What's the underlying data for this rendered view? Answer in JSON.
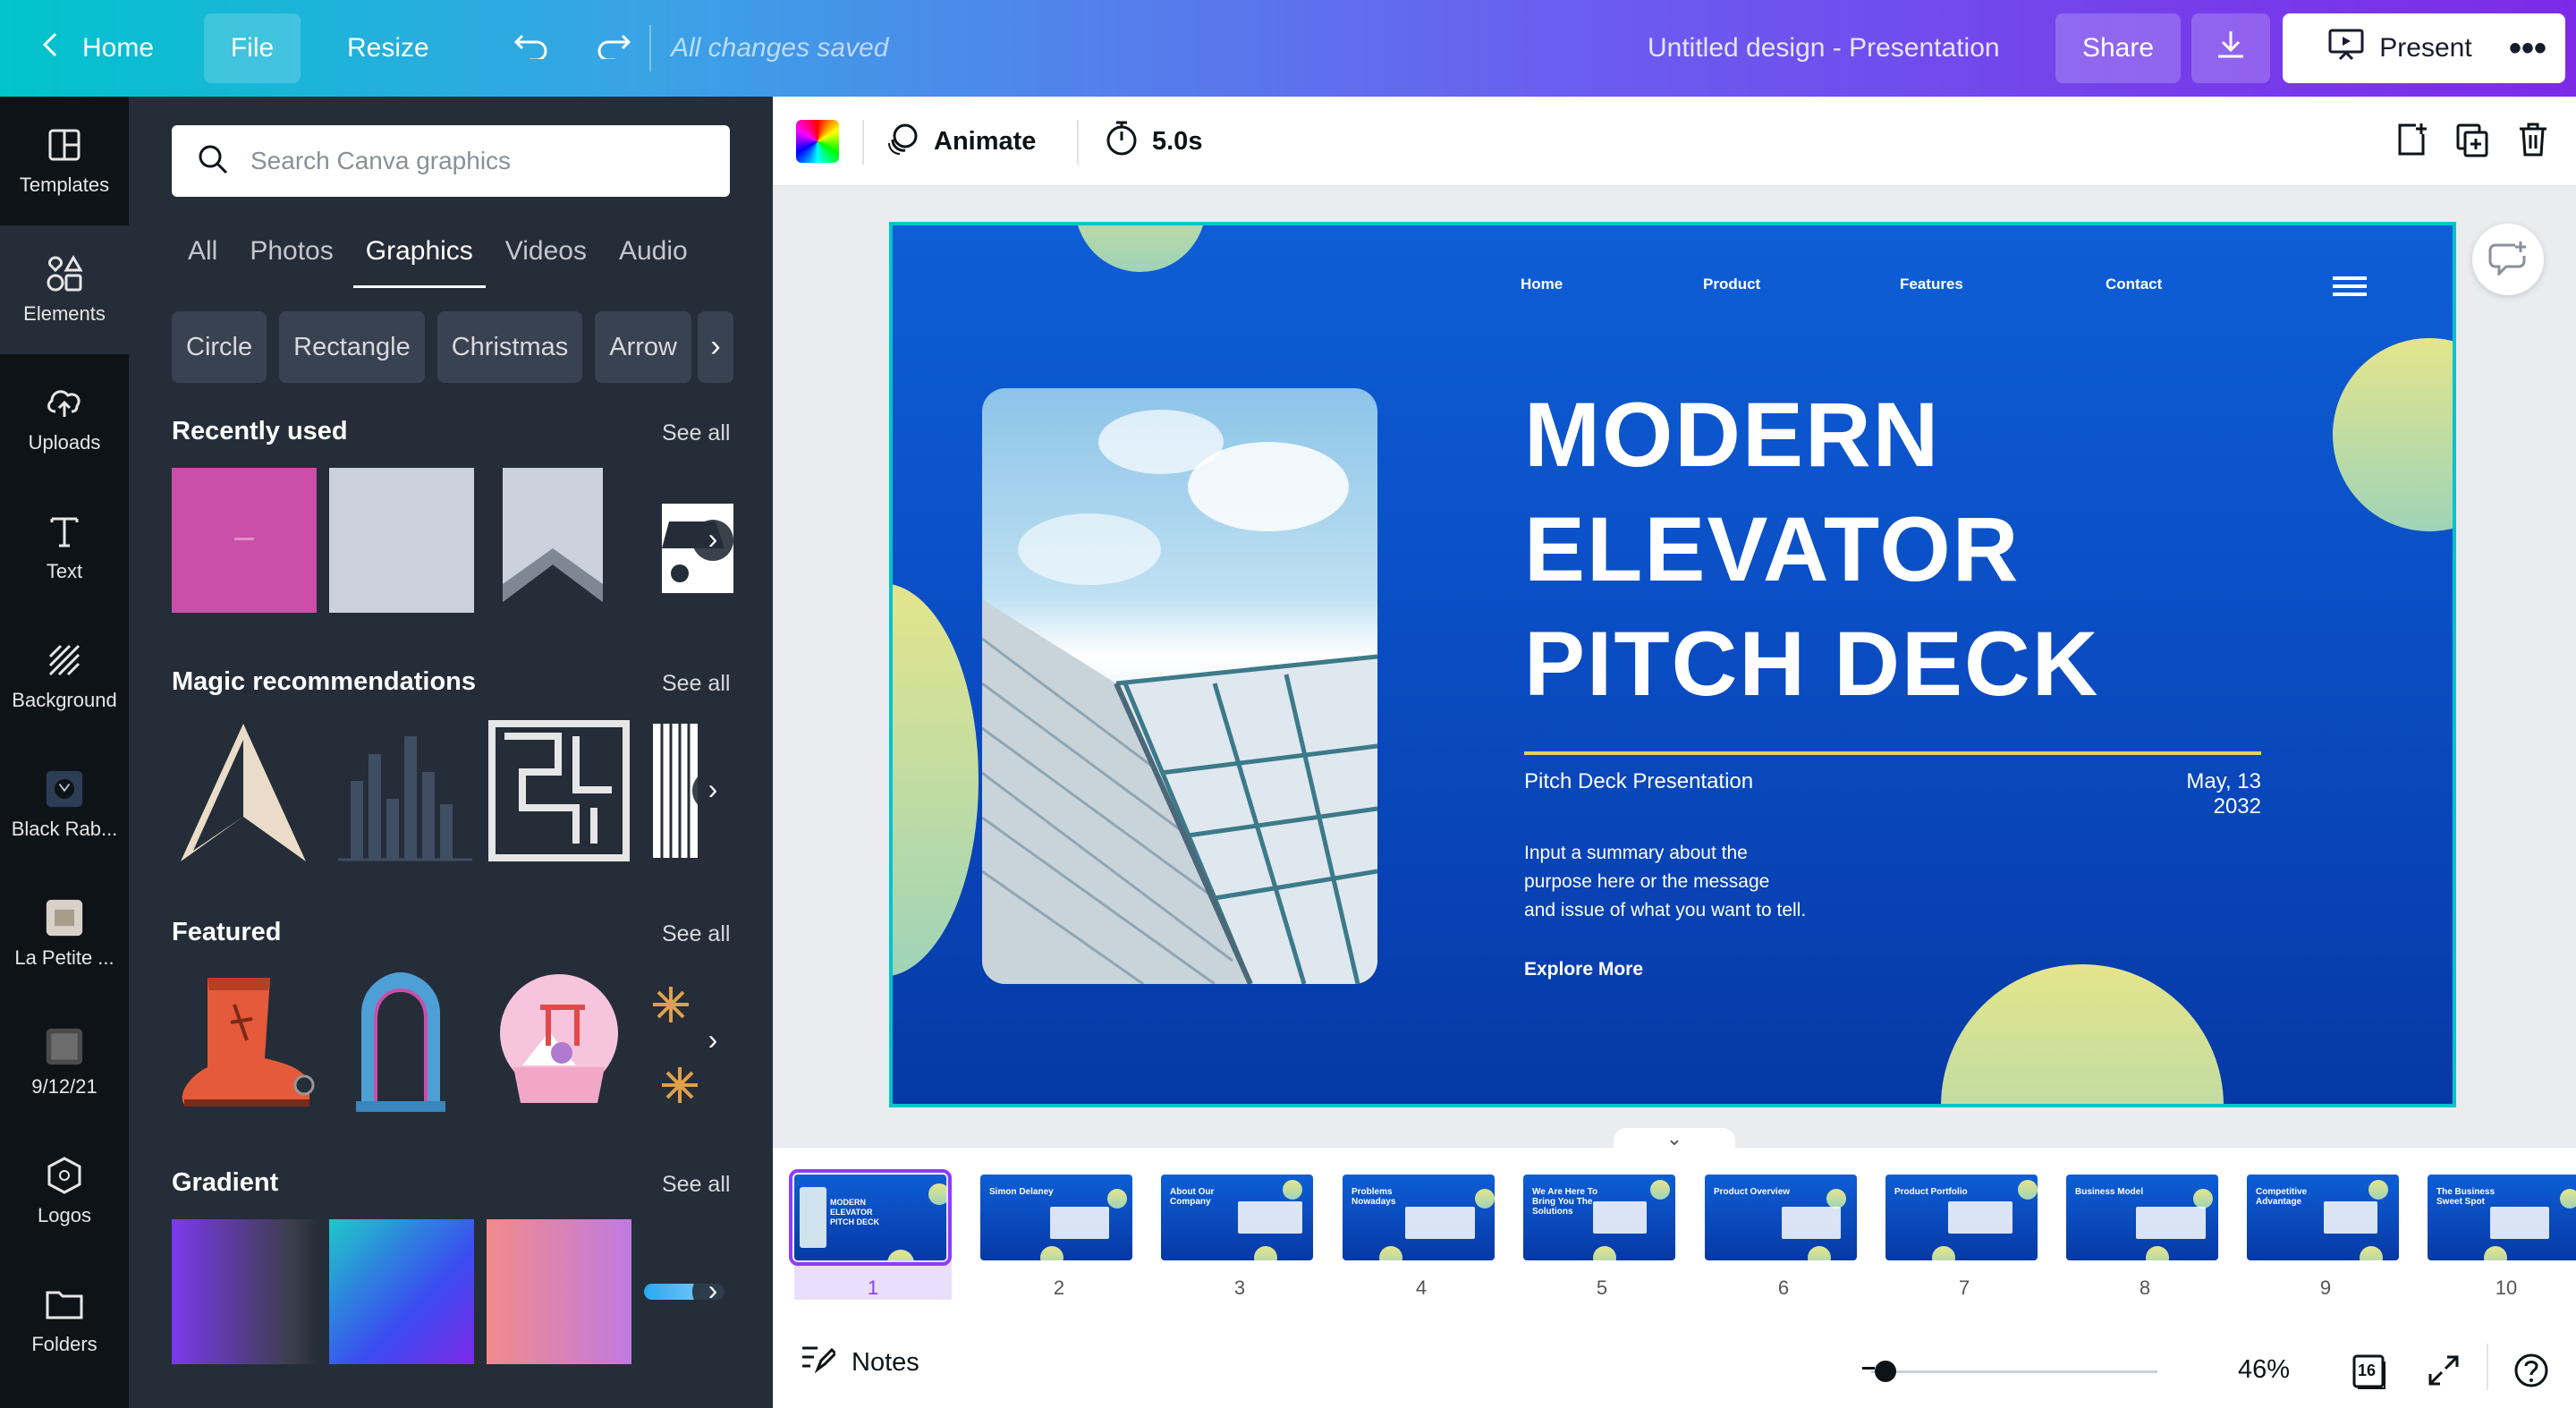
{
  "topbar": {
    "home": "Home",
    "file": "File",
    "resize": "Resize",
    "saved_status": "All changes saved",
    "doc_title": "Untitled design - Presentation",
    "share": "Share",
    "present": "Present"
  },
  "leftnav": [
    {
      "label": "Templates",
      "icon": "templates-icon"
    },
    {
      "label": "Elements",
      "icon": "elements-icon"
    },
    {
      "label": "Uploads",
      "icon": "upload-cloud-icon"
    },
    {
      "label": "Text",
      "icon": "text-icon"
    },
    {
      "label": "Background",
      "icon": "background-icon"
    },
    {
      "label": "Black Rab...",
      "icon": "folder-thumb-icon"
    },
    {
      "label": "La Petite ...",
      "icon": "folder-thumb-icon"
    },
    {
      "label": "9/12/21",
      "icon": "folder-thumb-icon"
    },
    {
      "label": "Logos",
      "icon": "logo-icon"
    },
    {
      "label": "Folders",
      "icon": "folder-icon"
    }
  ],
  "panel": {
    "search_placeholder": "Search Canva graphics",
    "tabs": [
      "All",
      "Photos",
      "Graphics",
      "Videos",
      "Audio"
    ],
    "active_tab": "Graphics",
    "chips": [
      "Circle",
      "Rectangle",
      "Christmas",
      "Arrow"
    ],
    "sections": [
      {
        "title": "Recently used",
        "see_all": "See all"
      },
      {
        "title": "Magic recommendations",
        "see_all": "See all"
      },
      {
        "title": "Featured",
        "see_all": "See all"
      },
      {
        "title": "Gradient",
        "see_all": "See all"
      }
    ]
  },
  "toolbar": {
    "animate": "Animate",
    "duration": "5.0s"
  },
  "slide": {
    "nav": [
      "Home",
      "Product",
      "Features",
      "Contact"
    ],
    "title_lines": [
      "MODERN",
      "ELEVATOR",
      "PITCH DECK"
    ],
    "subtitle": "Pitch Deck Presentation",
    "date": "May, 13 2032",
    "description": "Input a summary about the\npurpose here or the message\nand issue of what you want to tell.",
    "cta": "Explore More"
  },
  "pages": [
    {
      "num": "1",
      "title": "MODERN ELEVATOR PITCH DECK"
    },
    {
      "num": "2",
      "title": "Simon Delaney"
    },
    {
      "num": "3",
      "title": "About Our Company"
    },
    {
      "num": "4",
      "title": "Problems Nowadays"
    },
    {
      "num": "5",
      "title": "We Are Here To Bring You The Solutions"
    },
    {
      "num": "6",
      "title": "Product Overview"
    },
    {
      "num": "7",
      "title": "Product Portfolio"
    },
    {
      "num": "8",
      "title": "Business Model"
    },
    {
      "num": "9",
      "title": "Competitive Advantage"
    },
    {
      "num": "10",
      "title": "The Business Sweet Spot"
    }
  ],
  "bottombar": {
    "notes": "Notes",
    "zoom": "46%",
    "page_count": "16"
  },
  "colors": {
    "accent_purple": "#8b3dff",
    "accent_cyan": "#00c4cc",
    "slide_blue": "#0a4cc2",
    "slide_gold": "#d9d45a"
  }
}
